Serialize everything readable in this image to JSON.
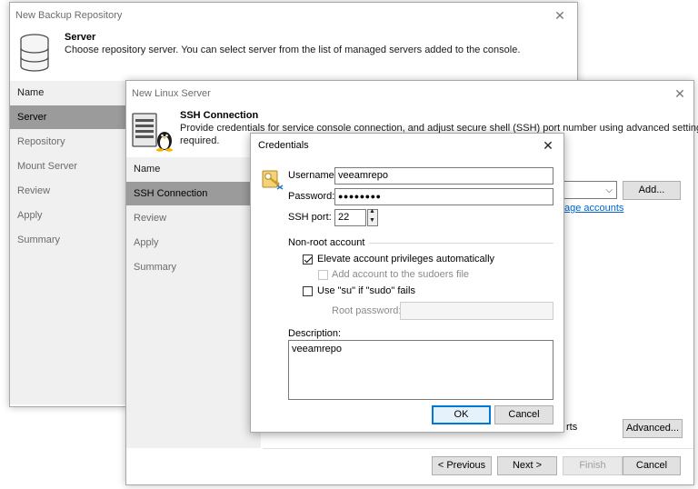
{
  "repo_window": {
    "title": "New Backup Repository",
    "header_title": "Server",
    "header_subtitle": "Choose repository server. You can select server from the list of managed servers added to the console.",
    "steps": [
      "Name",
      "Server",
      "Repository",
      "Mount Server",
      "Review",
      "Apply",
      "Summary"
    ],
    "active_step": "Server"
  },
  "linux_window": {
    "title": "New Linux Server",
    "header_title": "SSH Connection",
    "header_subtitle_1": "Provide credentials for service console connection, and adjust secure shell (SSH) port number using advanced settings if",
    "header_subtitle_2": "required.",
    "steps": [
      "Name",
      "SSH Connection",
      "Review",
      "Apply",
      "Summary"
    ],
    "active_step": "SSH Connection",
    "add_button": "Add...",
    "manage_accounts_link": "age accounts",
    "ports_text": "rts",
    "advanced_button": "Advanced...",
    "previous_button": "< Previous",
    "next_button": "Next >",
    "finish_button": "Finish",
    "cancel_button": "Cancel"
  },
  "credentials": {
    "title": "Credentials",
    "username_label": "Username:",
    "username_value": "veeamrepo",
    "password_label": "Password:",
    "password_value": "●●●●●●●●",
    "ssh_port_label": "SSH port:",
    "ssh_port_value": "22",
    "nonroot_group": "Non-root account",
    "elevate_label": "Elevate account privileges automatically",
    "elevate_checked": true,
    "sudoers_label": "Add account to the sudoers file",
    "sudoers_checked": false,
    "su_label": "Use \"su\" if \"sudo\" fails",
    "su_checked": false,
    "root_password_label": "Root password:",
    "description_label": "Description:",
    "description_value": "veeamrepo",
    "ok_button": "OK",
    "cancel_button": "Cancel"
  }
}
